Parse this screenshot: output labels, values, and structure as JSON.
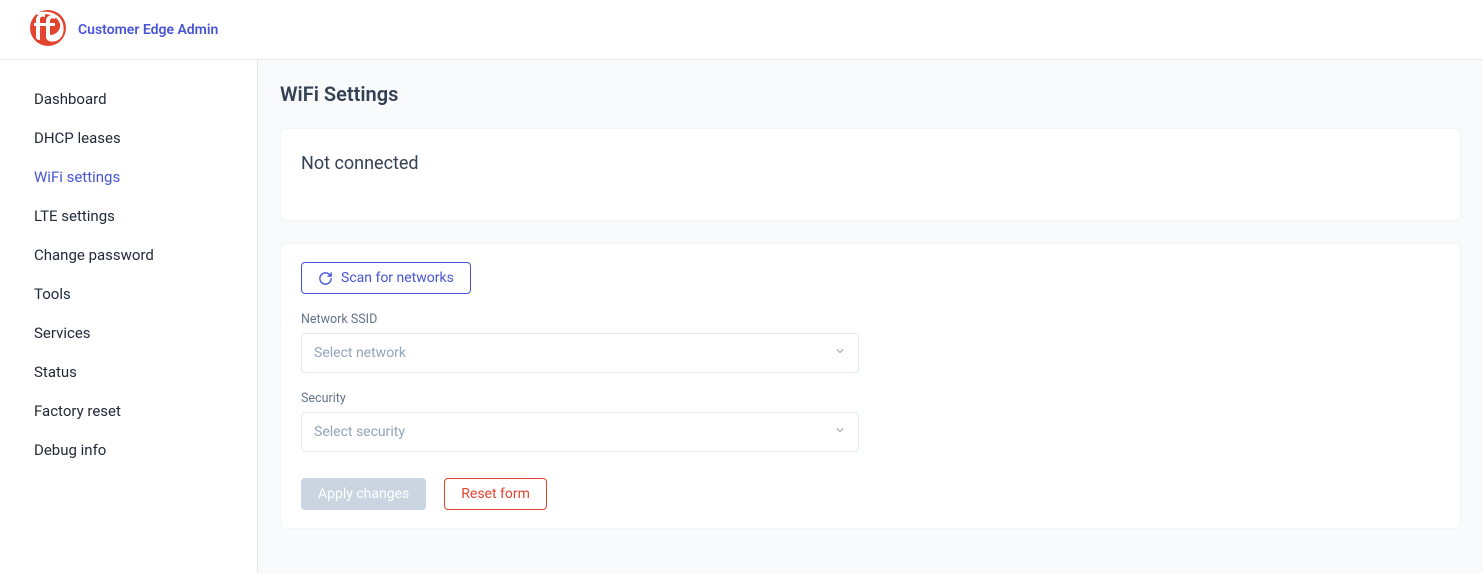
{
  "header": {
    "app_title": "Customer Edge Admin"
  },
  "sidebar": {
    "items": [
      {
        "label": "Dashboard",
        "active": false
      },
      {
        "label": "DHCP leases",
        "active": false
      },
      {
        "label": "WiFi settings",
        "active": true
      },
      {
        "label": "LTE settings",
        "active": false
      },
      {
        "label": "Change password",
        "active": false
      },
      {
        "label": "Tools",
        "active": false
      },
      {
        "label": "Services",
        "active": false
      },
      {
        "label": "Status",
        "active": false
      },
      {
        "label": "Factory reset",
        "active": false
      },
      {
        "label": "Debug info",
        "active": false
      }
    ]
  },
  "main": {
    "page_title": "WiFi Settings",
    "status": "Not connected",
    "scan_button": "Scan for networks",
    "ssid_label": "Network SSID",
    "ssid_placeholder": "Select network",
    "security_label": "Security",
    "security_placeholder": "Select security",
    "apply_label": "Apply changes",
    "reset_label": "Reset form"
  }
}
